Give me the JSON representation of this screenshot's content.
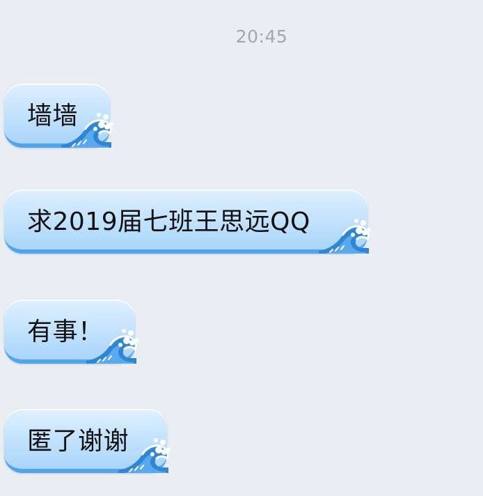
{
  "chat": {
    "timestamp": "20:45",
    "messages": [
      {
        "text": "墙墙"
      },
      {
        "text": "求2019届七班王思远QQ"
      },
      {
        "text": "有事！"
      },
      {
        "text": "匿了谢谢"
      }
    ]
  },
  "theme": {
    "background": "#eaedf1",
    "bubble_light": "#dff0ff",
    "bubble_dark": "#a9d5fa",
    "bubble_edge": "#4fa6ea",
    "timestamp_color": "#a3a7ad",
    "bubble_decoration": "ocean-wave-icon"
  }
}
